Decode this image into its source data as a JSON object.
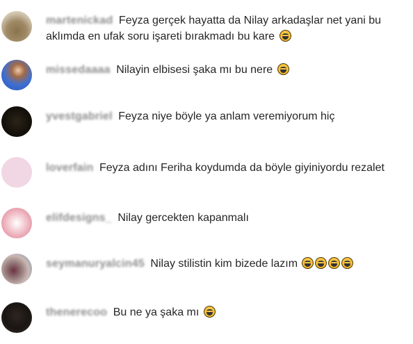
{
  "comments": [
    {
      "username": "martenickad",
      "text": "Feyza gerçek hayatta da Nilay arkadaşlar net yani bu aklımda en ufak soru işareti bırakmadı bu kare",
      "emoji_count": 1,
      "emoji_icon": "face-with-tears-of-joy-icon"
    },
    {
      "username": "missedaaaa",
      "text": "Nilayin elbisesi şaka mı bu nere",
      "emoji_count": 1,
      "emoji_icon": "face-with-tears-of-joy-icon"
    },
    {
      "username": "yvestgabriel",
      "text": "Feyza niye böyle ya anlam veremiyorum hiç",
      "emoji_count": 0
    },
    {
      "username": "loverfain",
      "text": "Feyza adını Feriha koydumda da böyle giyiniyordu rezalet",
      "emoji_count": 0
    },
    {
      "username": "elifdesigns_",
      "text": "Nilay gercekten kapanmalı",
      "emoji_count": 0
    },
    {
      "username": "seymanuryalcin45",
      "text": "Nilay stilistin kim bizede lazım",
      "emoji_count": 4,
      "emoji_icon": "face-with-tears-of-joy-icon"
    },
    {
      "username": "thenerecoo",
      "text": "Bu ne ya şaka mı",
      "emoji_count": 1,
      "emoji_icon": "face-with-tears-of-joy-icon"
    }
  ]
}
